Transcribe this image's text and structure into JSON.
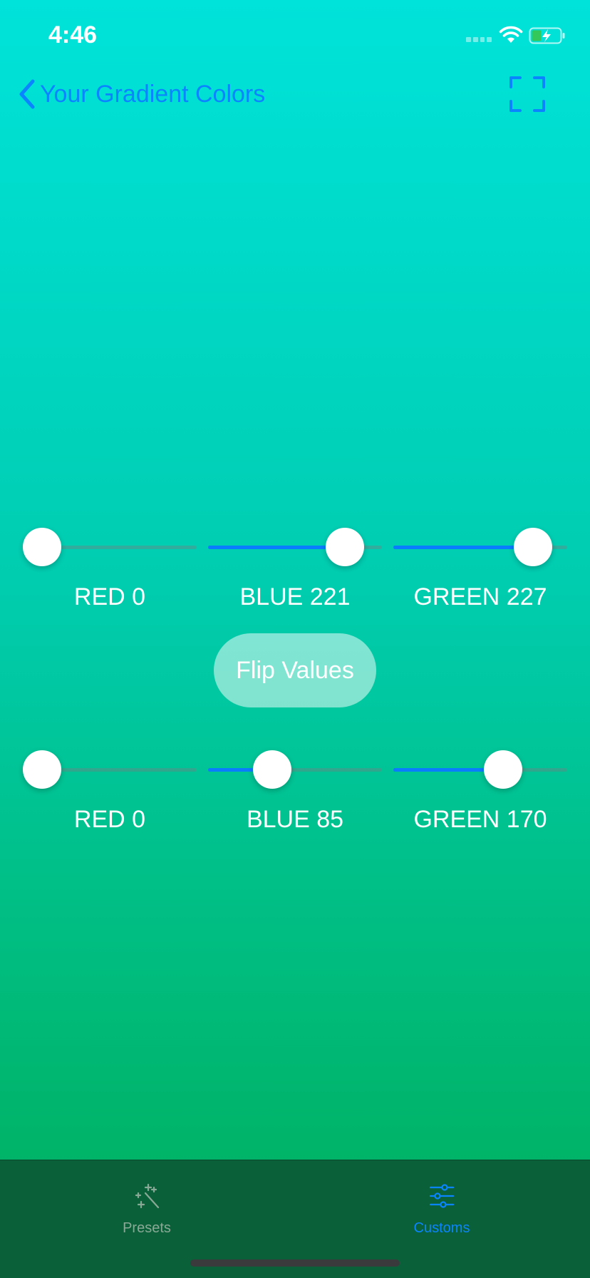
{
  "status_bar": {
    "time": "4:46"
  },
  "nav": {
    "back_label": "Your Gradient Colors",
    "back_icon": "chevron-left-icon",
    "fullscreen_icon": "fullscreen-icon"
  },
  "top_sliders": [
    {
      "label": "RED 0",
      "value": 0,
      "max": 255
    },
    {
      "label": "BLUE 221",
      "value": 221,
      "max": 255
    },
    {
      "label": "GREEN 227",
      "value": 227,
      "max": 255
    }
  ],
  "flip_button": {
    "label": "Flip Values"
  },
  "bottom_sliders": [
    {
      "label": "RED 0",
      "value": 0,
      "max": 255
    },
    {
      "label": "BLUE 85",
      "value": 85,
      "max": 255
    },
    {
      "label": "GREEN 170",
      "value": 170,
      "max": 255
    }
  ],
  "tab_bar": {
    "items": [
      {
        "label": "Presets",
        "icon": "magic-wand-icon",
        "selected": false
      },
      {
        "label": "Customs",
        "icon": "sliders-icon",
        "selected": true
      }
    ]
  },
  "colors": {
    "accent": "#0a84ff",
    "tab_bar_bg": "#0a6139",
    "tab_inactive": "#8aa896"
  }
}
